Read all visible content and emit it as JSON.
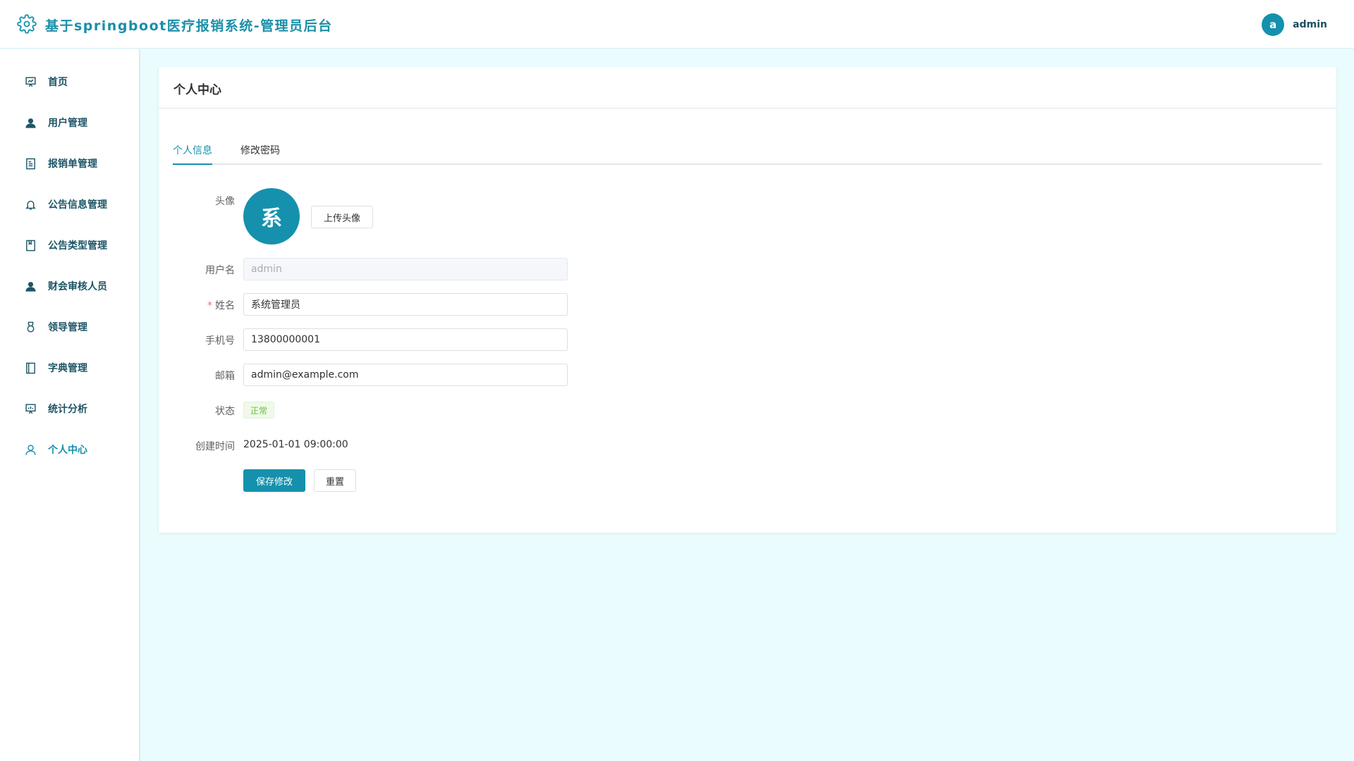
{
  "app": {
    "title": "基于springboot医疗报销系统-管理员后台",
    "accent_color": "#1591ad",
    "logo_icon": "gear-icon"
  },
  "header": {
    "user_avatar_letter": "a",
    "user_name": "admin"
  },
  "sidebar": {
    "items": [
      {
        "label": "首页",
        "icon": "presentation-chart-icon"
      },
      {
        "label": "用户管理",
        "icon": "user-icon"
      },
      {
        "label": "报销单管理",
        "icon": "document-icon"
      },
      {
        "label": "公告信息管理",
        "icon": "bell-icon"
      },
      {
        "label": "公告类型管理",
        "icon": "notebook-icon"
      },
      {
        "label": "财会审核人员",
        "icon": "user-icon"
      },
      {
        "label": "领导管理",
        "icon": "medal-icon"
      },
      {
        "label": "字典管理",
        "icon": "book-icon"
      },
      {
        "label": "统计分析",
        "icon": "presentation-chart-icon"
      },
      {
        "label": "个人中心",
        "icon": "user-outline-icon",
        "active": true
      }
    ]
  },
  "page": {
    "title": "个人中心",
    "tabs": [
      {
        "label": "个人信息",
        "active": true
      },
      {
        "label": "修改密码",
        "active": false
      }
    ]
  },
  "form": {
    "avatar_label": "头像",
    "avatar_char": "系",
    "upload_button": "上传头像",
    "username_label": "用户名",
    "username_value": "admin",
    "name_label": "姓名",
    "name_required_mark": "*",
    "name_value": "系统管理员",
    "phone_label": "手机号",
    "phone_value": "13800000001",
    "email_label": "邮箱",
    "email_value": "admin@example.com",
    "status_label": "状态",
    "status_value": "正常",
    "created_label": "创建时间",
    "created_value": "2025-01-01 09:00:00",
    "save_button": "保存修改",
    "reset_button": "重置"
  }
}
